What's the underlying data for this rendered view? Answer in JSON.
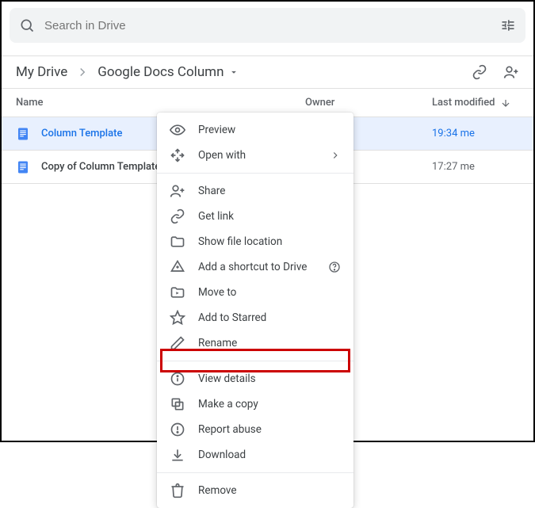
{
  "search": {
    "placeholder": "Search in Drive"
  },
  "breadcrumb": {
    "root": "My Drive",
    "current": "Google Docs Column"
  },
  "columns": {
    "name": "Name",
    "owner": "Owner",
    "modified": "Last modified"
  },
  "files": [
    {
      "name": "Column Template",
      "owner": "",
      "modified": "19:34 me",
      "selected": true
    },
    {
      "name": "Copy of Column Template",
      "owner": "",
      "modified": "17:27 me",
      "selected": false
    }
  ],
  "menu": {
    "preview": "Preview",
    "openwith": "Open with",
    "share": "Share",
    "getlink": "Get link",
    "showloc": "Show file location",
    "addshort": "Add a shortcut to Drive",
    "moveto": "Move to",
    "starred": "Add to Starred",
    "rename": "Rename",
    "details": "View details",
    "makecopy": "Make a copy",
    "report": "Report abuse",
    "download": "Download",
    "remove": "Remove"
  }
}
